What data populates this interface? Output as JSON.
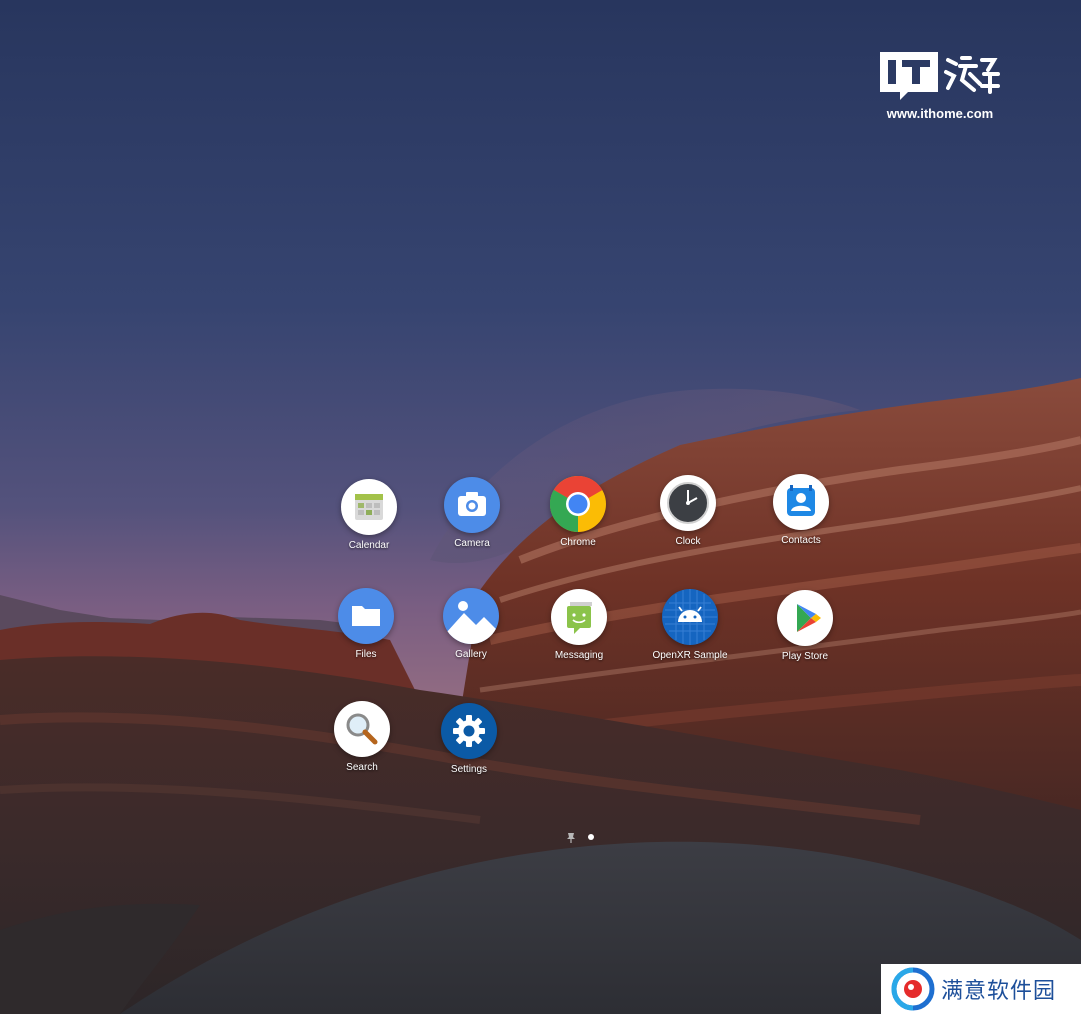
{
  "apps": [
    {
      "id": "calendar",
      "label": "Calendar",
      "icon": "calendar-icon"
    },
    {
      "id": "camera",
      "label": "Camera",
      "icon": "camera-icon"
    },
    {
      "id": "chrome",
      "label": "Chrome",
      "icon": "chrome-icon"
    },
    {
      "id": "clock",
      "label": "Clock",
      "icon": "clock-icon"
    },
    {
      "id": "contacts",
      "label": "Contacts",
      "icon": "contacts-icon"
    },
    {
      "id": "files",
      "label": "Files",
      "icon": "folder-icon"
    },
    {
      "id": "gallery",
      "label": "Gallery",
      "icon": "gallery-icon"
    },
    {
      "id": "messaging",
      "label": "Messaging",
      "icon": "messaging-icon"
    },
    {
      "id": "openxr",
      "label": "OpenXR Sample",
      "icon": "android-robot-icon"
    },
    {
      "id": "playstore",
      "label": "Play Store",
      "icon": "play-store-icon"
    },
    {
      "id": "search",
      "label": "Search",
      "icon": "magnifier-icon"
    },
    {
      "id": "settings",
      "label": "Settings",
      "icon": "gear-icon"
    }
  ],
  "watermark_top": {
    "logo_text": "IT之家",
    "url": "www.ithome.com"
  },
  "watermark_bottom": {
    "text": "满意软件园"
  },
  "colors": {
    "sky_top": "#2b3a63",
    "sky_horizon": "#7a5e80",
    "rock_red": "#7a3126",
    "label": "#ffffff",
    "badge_blue": "#1d4f9a"
  }
}
